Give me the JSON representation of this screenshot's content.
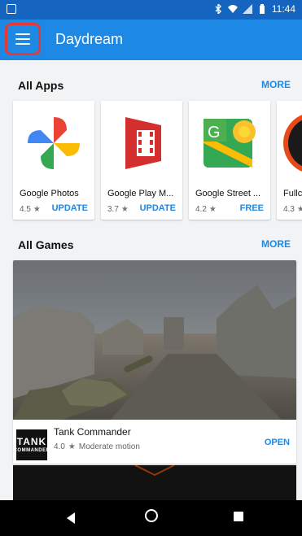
{
  "status_bar": {
    "time": "11:44",
    "icons": [
      "bluetooth-icon",
      "wifi-icon",
      "signal-icon",
      "battery-icon"
    ]
  },
  "app_bar": {
    "title": "Daydream",
    "menu_icon": "menu-icon"
  },
  "all_apps": {
    "title": "All Apps",
    "more_label": "MORE",
    "apps": [
      {
        "name": "Google Photos",
        "rating": "4.5",
        "action": "UPDATE",
        "icon": "google-photos-icon"
      },
      {
        "name": "Google Play M...",
        "rating": "3.7",
        "action": "UPDATE",
        "icon": "google-play-movies-icon"
      },
      {
        "name": "Google Street ...",
        "rating": "4.2",
        "action": "FREE",
        "icon": "google-street-view-icon"
      },
      {
        "name": "Fullc",
        "rating": "4.3",
        "action": "",
        "icon": "fulldive-icon"
      }
    ]
  },
  "all_games": {
    "title": "All Games",
    "more_label": "MORE",
    "featured": {
      "name": "Tank Commander",
      "rating": "4.0",
      "motion": "Moderate motion",
      "action": "OPEN",
      "thumb_text_1": "TANK",
      "thumb_text_2": "COMMANDER"
    }
  },
  "fab": {
    "icon": "vr-headset-icon"
  },
  "navigation": {
    "back_icon": "back-icon",
    "home_icon": "home-icon",
    "recent_icon": "recent-apps-icon"
  },
  "colors": {
    "status_bar": "#1565c0",
    "app_bar": "#1e88e5",
    "accent": "#1e88e5",
    "highlight": "#e53935",
    "background": "#f1f3f4"
  }
}
